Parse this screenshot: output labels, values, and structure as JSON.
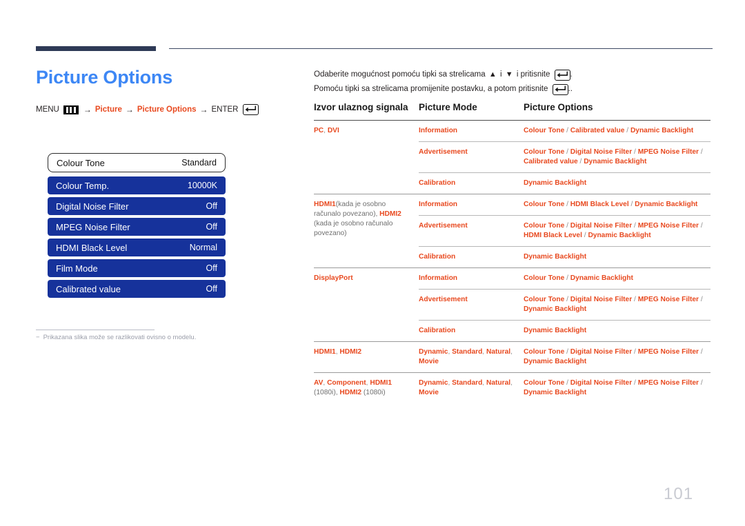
{
  "header": {
    "title": "Picture Options",
    "breadcrumb": {
      "menu_label": "MENU",
      "menu_icon": "menu-bars-icon",
      "arrow": "→",
      "step1": "Picture",
      "step2": "Picture Options",
      "enter_label": "ENTER",
      "enter_icon": "enter-key-icon"
    }
  },
  "instructions": {
    "line1_a": "Odaberite mogućnost pomoću tipki sa strelicama",
    "line1_up": "▲",
    "line1_i": "i",
    "line1_down": "▼",
    "line1_b": "i pritisnite",
    "line1_end": ".",
    "line2_a": "Pomoću tipki sa strelicama promijenite postavku, a potom pritisnite",
    "line2_end": ".."
  },
  "osd": {
    "rows": [
      {
        "label": "Colour Tone",
        "value": "Standard",
        "style": "outlined"
      },
      {
        "label": "Colour Temp.",
        "value": "10000K",
        "style": "blue"
      },
      {
        "label": "Digital Noise Filter",
        "value": "Off",
        "style": "blue"
      },
      {
        "label": "MPEG Noise Filter",
        "value": "Off",
        "style": "blue"
      },
      {
        "label": "HDMI Black Level",
        "value": "Normal",
        "style": "blue"
      },
      {
        "label": "Film Mode",
        "value": "Off",
        "style": "blue"
      },
      {
        "label": "Calibrated value",
        "value": "Off",
        "style": "blue"
      }
    ]
  },
  "note": {
    "dash": "−",
    "text": "Prikazana slika može se razlikovati ovisno o modelu."
  },
  "table": {
    "headers": {
      "source": "Izvor ulaznog signala",
      "mode": "Picture Mode",
      "options": "Picture Options"
    },
    "groups": [
      {
        "source_parts": [
          {
            "t": "PC",
            "c": "org"
          },
          {
            "t": ", ",
            "c": "sep"
          },
          {
            "t": "DVI",
            "c": "org"
          }
        ],
        "rows": [
          {
            "mode_parts": [
              {
                "t": "Information",
                "c": "org"
              }
            ],
            "option_parts": [
              {
                "t": "Colour Tone",
                "c": "org"
              },
              {
                "t": " / ",
                "c": "sep"
              },
              {
                "t": "Calibrated value",
                "c": "org"
              },
              {
                "t": " / ",
                "c": "sep"
              },
              {
                "t": "Dynamic Backlight",
                "c": "org"
              }
            ]
          },
          {
            "mode_parts": [
              {
                "t": "Advertisement",
                "c": "org"
              }
            ],
            "option_parts": [
              {
                "t": "Colour Tone",
                "c": "org"
              },
              {
                "t": " / ",
                "c": "sep"
              },
              {
                "t": "Digital Noise Filter",
                "c": "org"
              },
              {
                "t": " / ",
                "c": "sep"
              },
              {
                "t": "MPEG Noise Filter",
                "c": "org"
              },
              {
                "t": " / ",
                "c": "sep"
              },
              {
                "t": "Calibrated value",
                "c": "org"
              },
              {
                "t": " / ",
                "c": "sep"
              },
              {
                "t": "Dynamic Backlight",
                "c": "org"
              }
            ]
          },
          {
            "mode_parts": [
              {
                "t": "Calibration",
                "c": "org"
              }
            ],
            "option_parts": [
              {
                "t": "Dynamic Backlight",
                "c": "org"
              }
            ]
          }
        ]
      },
      {
        "source_parts": [
          {
            "t": "HDMI1",
            "c": "org"
          },
          {
            "t": "(kada je osobno računalo povezano), ",
            "c": "gry"
          },
          {
            "t": "HDMI2",
            "c": "org"
          },
          {
            "t": " (kada je osobno računalo povezano)",
            "c": "gry"
          }
        ],
        "rows": [
          {
            "mode_parts": [
              {
                "t": "Information",
                "c": "org"
              }
            ],
            "option_parts": [
              {
                "t": "Colour Tone",
                "c": "org"
              },
              {
                "t": " / ",
                "c": "sep"
              },
              {
                "t": "HDMI Black Level",
                "c": "org"
              },
              {
                "t": " / ",
                "c": "sep"
              },
              {
                "t": "Dynamic Backlight",
                "c": "org"
              }
            ]
          },
          {
            "mode_parts": [
              {
                "t": "Advertisement",
                "c": "org"
              }
            ],
            "option_parts": [
              {
                "t": "Colour Tone",
                "c": "org"
              },
              {
                "t": " / ",
                "c": "sep"
              },
              {
                "t": "Digital Noise Filter",
                "c": "org"
              },
              {
                "t": " / ",
                "c": "sep"
              },
              {
                "t": "MPEG Noise Filter",
                "c": "org"
              },
              {
                "t": " / ",
                "c": "sep"
              },
              {
                "t": "HDMI Black Level",
                "c": "org"
              },
              {
                "t": " / ",
                "c": "sep"
              },
              {
                "t": "Dynamic Backlight",
                "c": "org"
              }
            ]
          },
          {
            "mode_parts": [
              {
                "t": "Calibration",
                "c": "org"
              }
            ],
            "option_parts": [
              {
                "t": "Dynamic Backlight",
                "c": "org"
              }
            ]
          }
        ]
      },
      {
        "source_parts": [
          {
            "t": "DisplayPort",
            "c": "org"
          }
        ],
        "rows": [
          {
            "mode_parts": [
              {
                "t": "Information",
                "c": "org"
              }
            ],
            "option_parts": [
              {
                "t": "Colour Tone",
                "c": "org"
              },
              {
                "t": " / ",
                "c": "sep"
              },
              {
                "t": "Dynamic Backlight",
                "c": "org"
              }
            ]
          },
          {
            "mode_parts": [
              {
                "t": "Advertisement",
                "c": "org"
              }
            ],
            "option_parts": [
              {
                "t": "Colour Tone",
                "c": "org"
              },
              {
                "t": " / ",
                "c": "sep"
              },
              {
                "t": "Digital Noise Filter",
                "c": "org"
              },
              {
                "t": " / ",
                "c": "sep"
              },
              {
                "t": "MPEG Noise Filter",
                "c": "org"
              },
              {
                "t": " / ",
                "c": "sep"
              },
              {
                "t": "Dynamic Backlight",
                "c": "org"
              }
            ]
          },
          {
            "mode_parts": [
              {
                "t": "Calibration",
                "c": "org"
              }
            ],
            "option_parts": [
              {
                "t": "Dynamic Backlight",
                "c": "org"
              }
            ]
          }
        ]
      },
      {
        "source_parts": [
          {
            "t": "HDMI1",
            "c": "org"
          },
          {
            "t": ", ",
            "c": "sep"
          },
          {
            "t": "HDMI2",
            "c": "org"
          }
        ],
        "rows": [
          {
            "mode_parts": [
              {
                "t": "Dynamic",
                "c": "org"
              },
              {
                "t": ", ",
                "c": "sep"
              },
              {
                "t": "Standard",
                "c": "org"
              },
              {
                "t": ", ",
                "c": "sep"
              },
              {
                "t": "Natural",
                "c": "org"
              },
              {
                "t": ", ",
                "c": "sep"
              },
              {
                "t": "Movie",
                "c": "org"
              }
            ],
            "option_parts": [
              {
                "t": "Colour Tone",
                "c": "org"
              },
              {
                "t": " / ",
                "c": "sep"
              },
              {
                "t": "Digital Noise Filter",
                "c": "org"
              },
              {
                "t": " / ",
                "c": "sep"
              },
              {
                "t": "MPEG Noise Filter",
                "c": "org"
              },
              {
                "t": " / ",
                "c": "sep"
              },
              {
                "t": "Dynamic Backlight",
                "c": "org"
              }
            ]
          }
        ]
      },
      {
        "source_parts": [
          {
            "t": "AV",
            "c": "org"
          },
          {
            "t": ", ",
            "c": "sep"
          },
          {
            "t": "Component",
            "c": "org"
          },
          {
            "t": ", ",
            "c": "sep"
          },
          {
            "t": "HDMI1",
            "c": "org"
          },
          {
            "t": " (1080i), ",
            "c": "gry"
          },
          {
            "t": "HDMI2",
            "c": "org"
          },
          {
            "t": " (1080i)",
            "c": "gry"
          }
        ],
        "rows": [
          {
            "mode_parts": [
              {
                "t": "Dynamic",
                "c": "org"
              },
              {
                "t": ", ",
                "c": "sep"
              },
              {
                "t": "Standard",
                "c": "org"
              },
              {
                "t": ", ",
                "c": "sep"
              },
              {
                "t": "Natural",
                "c": "org"
              },
              {
                "t": ", ",
                "c": "sep"
              },
              {
                "t": "Movie",
                "c": "org"
              }
            ],
            "option_parts": [
              {
                "t": "Colour Tone",
                "c": "org"
              },
              {
                "t": " / ",
                "c": "sep"
              },
              {
                "t": "Digital Noise Filter",
                "c": "org"
              },
              {
                "t": " / ",
                "c": "sep"
              },
              {
                "t": "MPEG Noise Filter",
                "c": "org"
              },
              {
                "t": " / ",
                "c": "sep"
              },
              {
                "t": "Dynamic Backlight",
                "c": "org"
              }
            ]
          }
        ]
      }
    ]
  },
  "footer": {
    "page_number": "101"
  },
  "colors": {
    "heading_blue": "#3d87f5",
    "accent_orange": "#e8491f",
    "osd_blue": "#16329b",
    "rule_navy": "#2e3a56"
  }
}
